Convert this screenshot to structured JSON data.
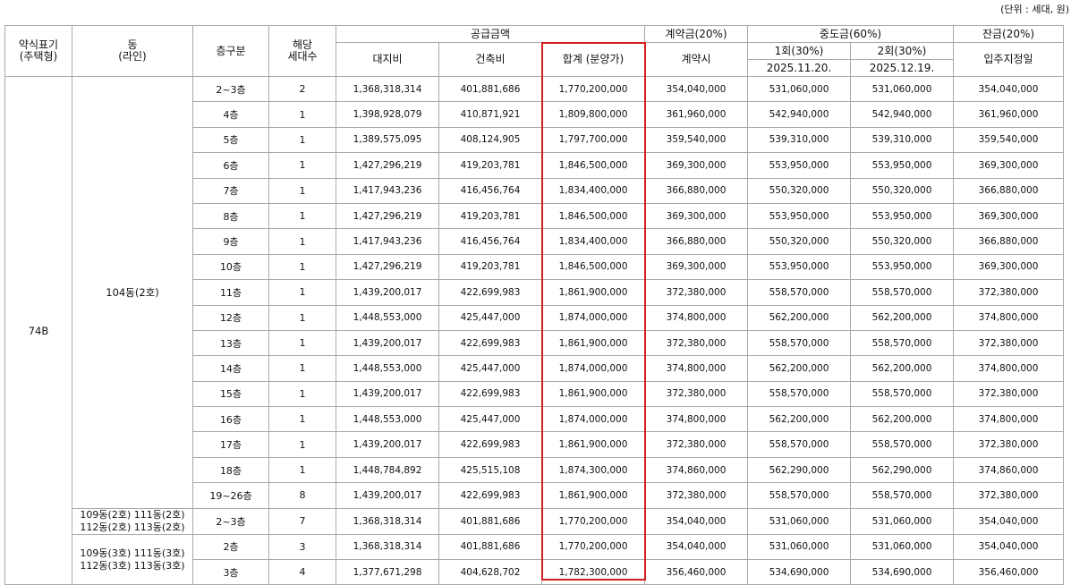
{
  "unit_note": "(단위 : 세대, 원)",
  "headers": {
    "type": "약식표기\n(주택형)",
    "dong": "동\n(라인)",
    "floor": "층구분",
    "units": "해당\n세대수",
    "supply": "공급금액",
    "land": "대지비",
    "building": "건축비",
    "total": "합계 (분양가)",
    "deposit": "계약금(20%)",
    "deposit_sub": "계약시",
    "mid": "중도금(60%)",
    "mid1": "1회(30%)",
    "mid1_date": "2025.11.20.",
    "mid2": "2회(30%)",
    "mid2_date": "2025.12.19.",
    "balance": "잔금(20%)",
    "balance_sub": "입주지정일"
  },
  "house_type": "74B",
  "groups": [
    {
      "dong": "104동(2호)",
      "rows": [
        {
          "floor": "2~3층",
          "units": "2",
          "land": "1,368,318,314",
          "building": "401,881,686",
          "total": "1,770,200,000",
          "deposit": "354,040,000",
          "mid1": "531,060,000",
          "mid2": "531,060,000",
          "balance": "354,040,000"
        },
        {
          "floor": "4층",
          "units": "1",
          "land": "1,398,928,079",
          "building": "410,871,921",
          "total": "1,809,800,000",
          "deposit": "361,960,000",
          "mid1": "542,940,000",
          "mid2": "542,940,000",
          "balance": "361,960,000"
        },
        {
          "floor": "5층",
          "units": "1",
          "land": "1,389,575,095",
          "building": "408,124,905",
          "total": "1,797,700,000",
          "deposit": "359,540,000",
          "mid1": "539,310,000",
          "mid2": "539,310,000",
          "balance": "359,540,000"
        },
        {
          "floor": "6층",
          "units": "1",
          "land": "1,427,296,219",
          "building": "419,203,781",
          "total": "1,846,500,000",
          "deposit": "369,300,000",
          "mid1": "553,950,000",
          "mid2": "553,950,000",
          "balance": "369,300,000"
        },
        {
          "floor": "7층",
          "units": "1",
          "land": "1,417,943,236",
          "building": "416,456,764",
          "total": "1,834,400,000",
          "deposit": "366,880,000",
          "mid1": "550,320,000",
          "mid2": "550,320,000",
          "balance": "366,880,000"
        },
        {
          "floor": "8층",
          "units": "1",
          "land": "1,427,296,219",
          "building": "419,203,781",
          "total": "1,846,500,000",
          "deposit": "369,300,000",
          "mid1": "553,950,000",
          "mid2": "553,950,000",
          "balance": "369,300,000"
        },
        {
          "floor": "9층",
          "units": "1",
          "land": "1,417,943,236",
          "building": "416,456,764",
          "total": "1,834,400,000",
          "deposit": "366,880,000",
          "mid1": "550,320,000",
          "mid2": "550,320,000",
          "balance": "366,880,000"
        },
        {
          "floor": "10층",
          "units": "1",
          "land": "1,427,296,219",
          "building": "419,203,781",
          "total": "1,846,500,000",
          "deposit": "369,300,000",
          "mid1": "553,950,000",
          "mid2": "553,950,000",
          "balance": "369,300,000"
        },
        {
          "floor": "11층",
          "units": "1",
          "land": "1,439,200,017",
          "building": "422,699,983",
          "total": "1,861,900,000",
          "deposit": "372,380,000",
          "mid1": "558,570,000",
          "mid2": "558,570,000",
          "balance": "372,380,000"
        },
        {
          "floor": "12층",
          "units": "1",
          "land": "1,448,553,000",
          "building": "425,447,000",
          "total": "1,874,000,000",
          "deposit": "374,800,000",
          "mid1": "562,200,000",
          "mid2": "562,200,000",
          "balance": "374,800,000"
        },
        {
          "floor": "13층",
          "units": "1",
          "land": "1,439,200,017",
          "building": "422,699,983",
          "total": "1,861,900,000",
          "deposit": "372,380,000",
          "mid1": "558,570,000",
          "mid2": "558,570,000",
          "balance": "372,380,000"
        },
        {
          "floor": "14층",
          "units": "1",
          "land": "1,448,553,000",
          "building": "425,447,000",
          "total": "1,874,000,000",
          "deposit": "374,800,000",
          "mid1": "562,200,000",
          "mid2": "562,200,000",
          "balance": "374,800,000"
        },
        {
          "floor": "15층",
          "units": "1",
          "land": "1,439,200,017",
          "building": "422,699,983",
          "total": "1,861,900,000",
          "deposit": "372,380,000",
          "mid1": "558,570,000",
          "mid2": "558,570,000",
          "balance": "372,380,000"
        },
        {
          "floor": "16층",
          "units": "1",
          "land": "1,448,553,000",
          "building": "425,447,000",
          "total": "1,874,000,000",
          "deposit": "374,800,000",
          "mid1": "562,200,000",
          "mid2": "562,200,000",
          "balance": "374,800,000"
        },
        {
          "floor": "17층",
          "units": "1",
          "land": "1,439,200,017",
          "building": "422,699,983",
          "total": "1,861,900,000",
          "deposit": "372,380,000",
          "mid1": "558,570,000",
          "mid2": "558,570,000",
          "balance": "372,380,000"
        },
        {
          "floor": "18층",
          "units": "1",
          "land": "1,448,784,892",
          "building": "425,515,108",
          "total": "1,874,300,000",
          "deposit": "374,860,000",
          "mid1": "562,290,000",
          "mid2": "562,290,000",
          "balance": "374,860,000"
        },
        {
          "floor": "19~26층",
          "units": "8",
          "land": "1,439,200,017",
          "building": "422,699,983",
          "total": "1,861,900,000",
          "deposit": "372,380,000",
          "mid1": "558,570,000",
          "mid2": "558,570,000",
          "balance": "372,380,000"
        }
      ]
    },
    {
      "dong": "109동(2호) 111동(2호)\n112동(2호) 113동(2호)",
      "rows": [
        {
          "floor": "2~3층",
          "units": "7",
          "land": "1,368,318,314",
          "building": "401,881,686",
          "total": "1,770,200,000",
          "deposit": "354,040,000",
          "mid1": "531,060,000",
          "mid2": "531,060,000",
          "balance": "354,040,000"
        }
      ]
    },
    {
      "dong": "109동(3호) 111동(3호)\n112동(3호) 113동(3호)",
      "rows": [
        {
          "floor": "2층",
          "units": "3",
          "land": "1,368,318,314",
          "building": "401,881,686",
          "total": "1,770,200,000",
          "deposit": "354,040,000",
          "mid1": "531,060,000",
          "mid2": "531,060,000",
          "balance": "354,040,000"
        },
        {
          "floor": "3층",
          "units": "4",
          "land": "1,377,671,298",
          "building": "404,628,702",
          "total": "1,782,300,000",
          "deposit": "356,460,000",
          "mid1": "534,690,000",
          "mid2": "534,690,000",
          "balance": "356,460,000"
        }
      ]
    }
  ],
  "highlight_color": "#d21f1f"
}
